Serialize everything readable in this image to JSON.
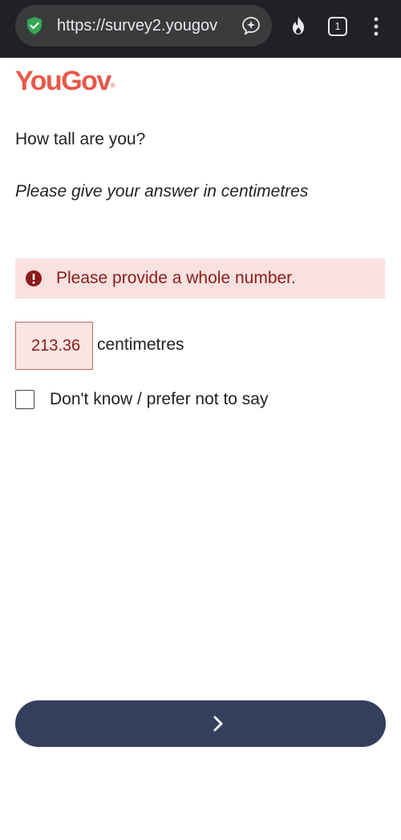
{
  "browser": {
    "url": "https://survey2.yougov",
    "tab_count": "1",
    "icons": {
      "security": "shield-check-icon",
      "assistant": "ai-sparkle-icon",
      "burn": "flame-icon",
      "tabs": "tab-switcher-icon",
      "menu": "vertical-dots-icon"
    },
    "colors": {
      "bar": "#202124",
      "pill": "#3a3b3d",
      "shield": "#34a853"
    }
  },
  "brand": {
    "logo_text": "YouGov",
    "logo_mark": "®",
    "color": "#e8584a"
  },
  "question": {
    "text": "How tall are you?",
    "instruction": "Please give your answer in centimetres"
  },
  "error": {
    "message": "Please provide a whole number.",
    "icon": "exclamation-circle-icon",
    "text_color": "#8a1c1c",
    "background": "#f9e1df"
  },
  "answer": {
    "value": "213.36",
    "unit": "centimetres"
  },
  "dont_know": {
    "label": "Don't know / prefer not to say",
    "checked": false
  },
  "navigation": {
    "next_icon": "chevron-right-icon",
    "button_color": "#333f5c"
  }
}
